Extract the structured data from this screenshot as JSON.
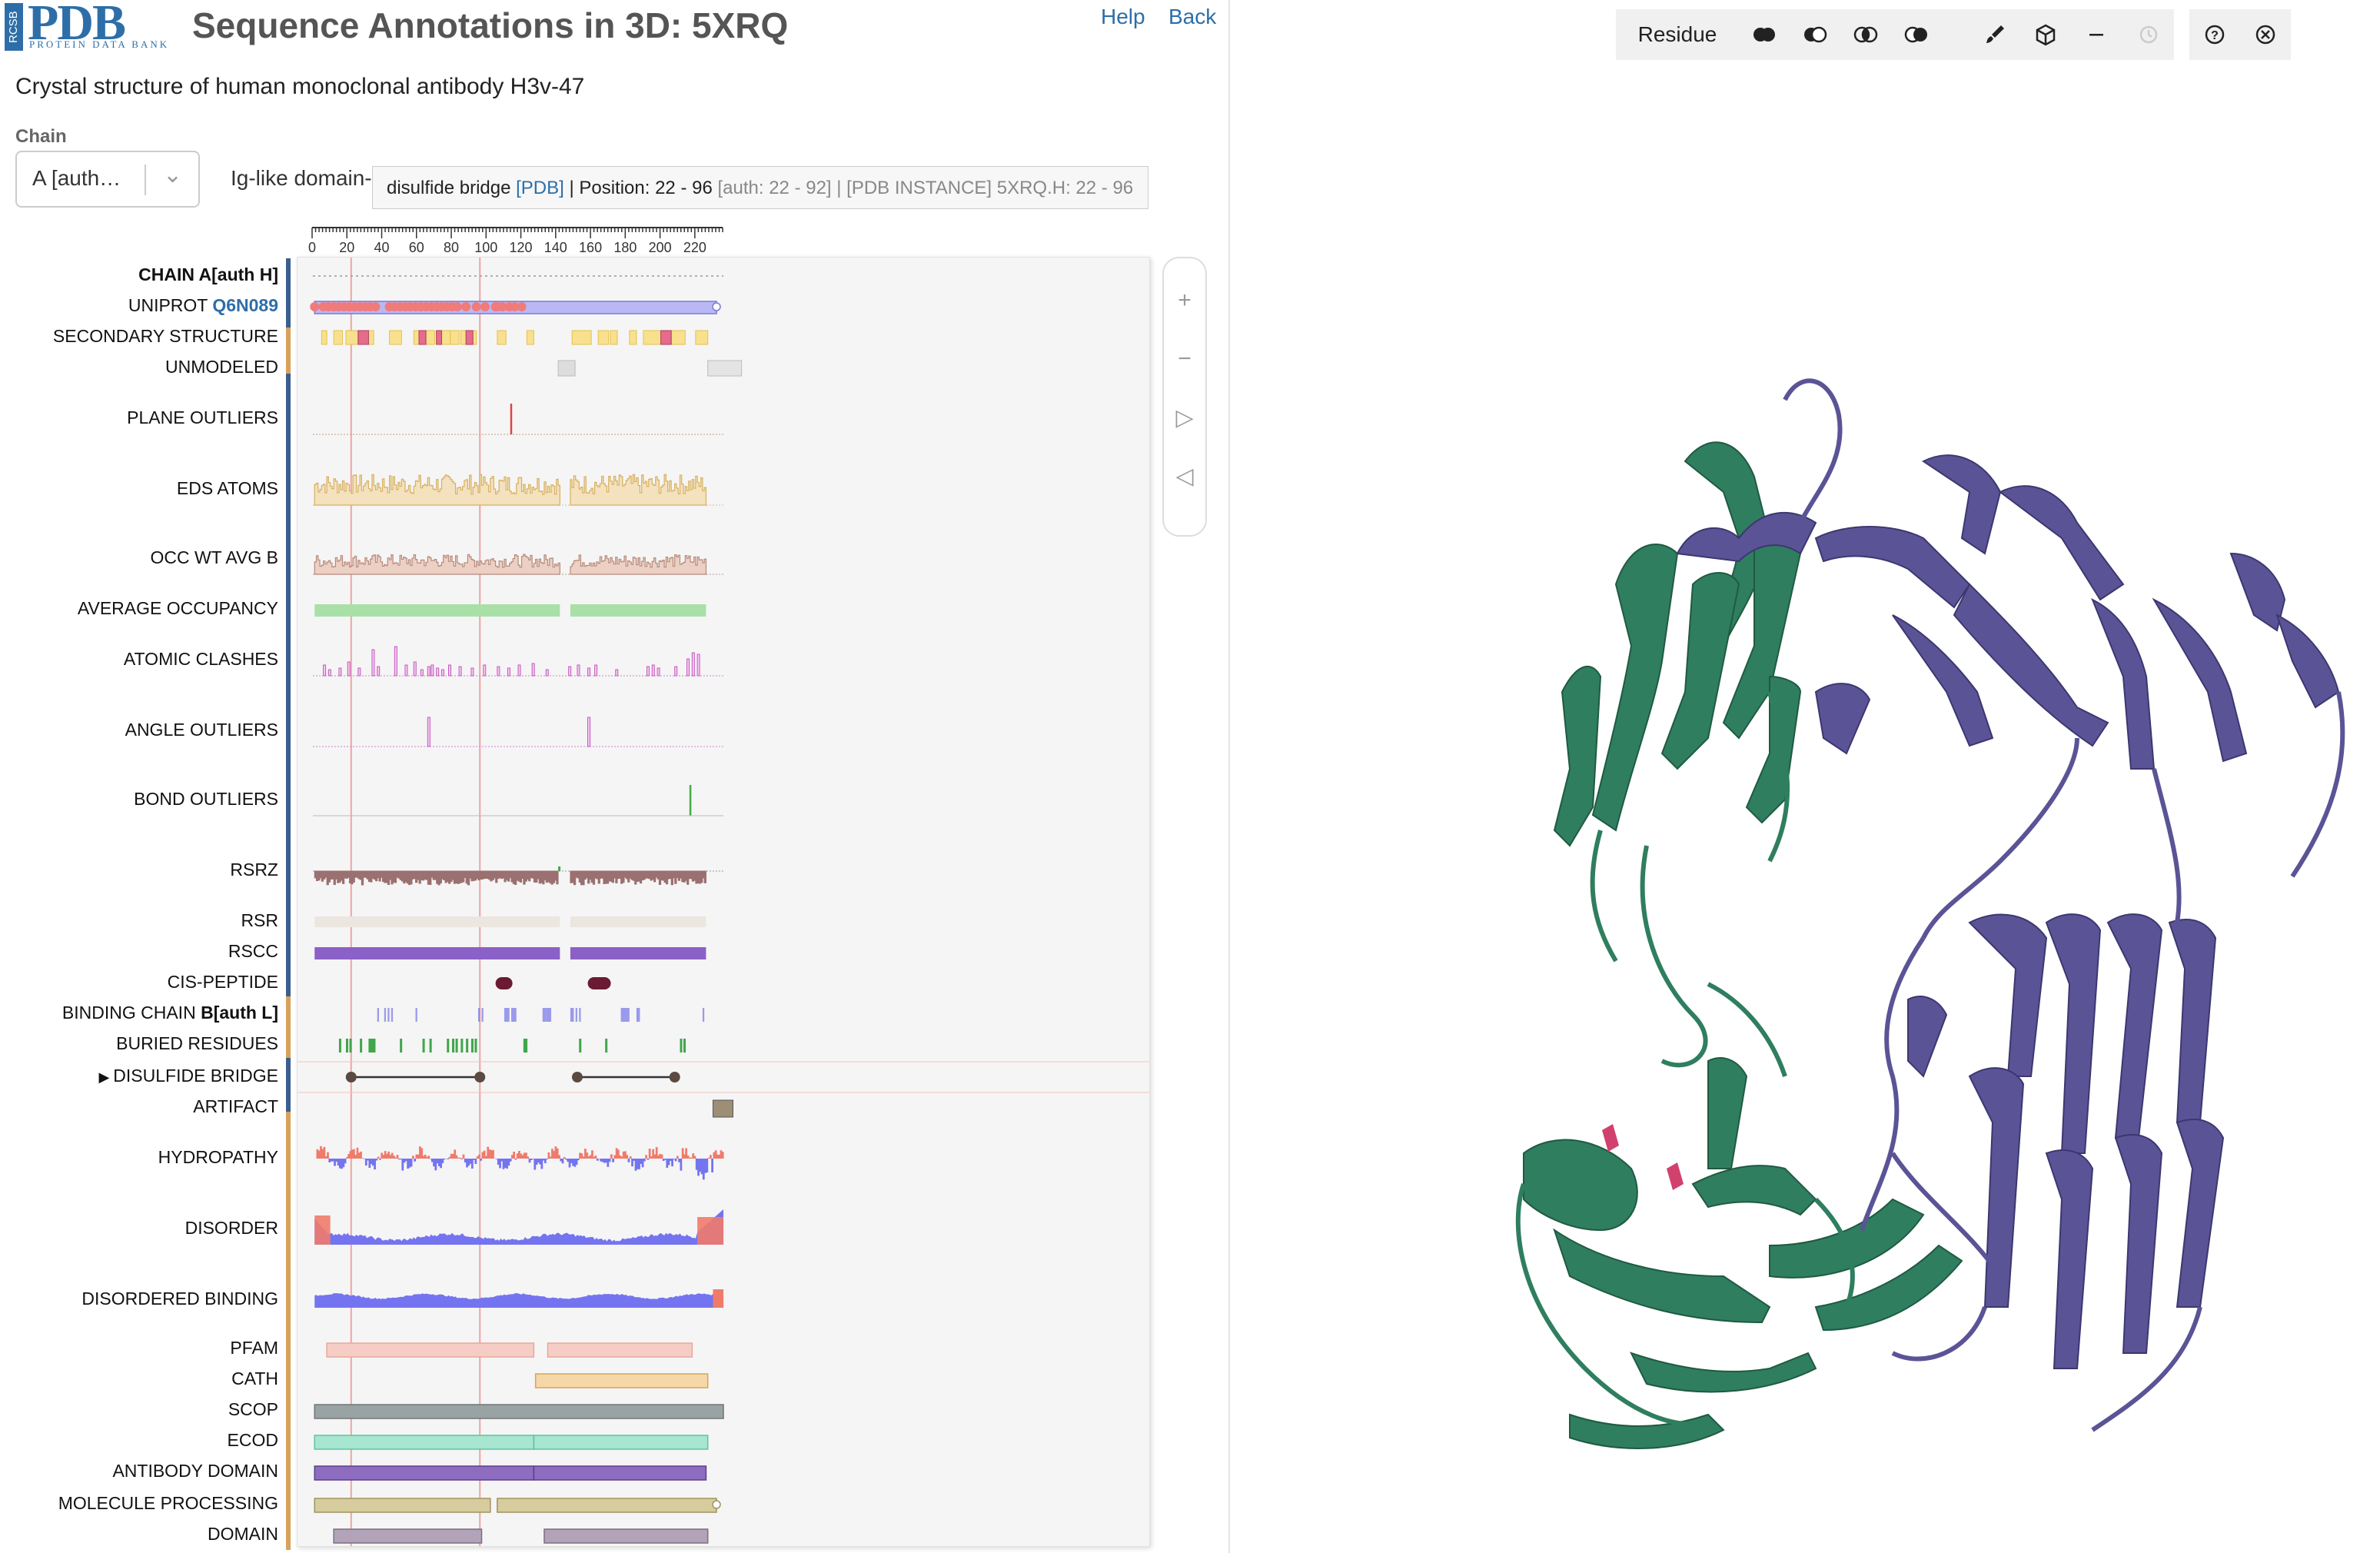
{
  "header": {
    "logo_mark": "RCSB",
    "logo_text": "PDB",
    "logo_sub": "PROTEIN DATA BANK",
    "title": "Sequence Annotations in 3D: 5XRQ",
    "help": "Help",
    "back": "Back",
    "subtitle": "Crystal structure of human monoclonal antibody H3v-47"
  },
  "chain": {
    "label": "Chain",
    "selected": "A [auth…",
    "domain_label": "Ig-like domain-"
  },
  "tooltip": {
    "prefix": "disulfide bridge ",
    "source": "[PDB]",
    "position": " | Position: 22 - 96 ",
    "details": "[auth: 22 - 92] | [PDB INSTANCE] 5XRQ.H: 22 - 96"
  },
  "axis": {
    "ticks": [
      "0",
      "20",
      "40",
      "60",
      "80",
      "100",
      "120",
      "140",
      "160",
      "180",
      "200",
      "220"
    ]
  },
  "tracks": [
    {
      "id": "chain",
      "label_bold": "CHAIN A[auth H]"
    },
    {
      "id": "uniprot",
      "label": "UNIPROT",
      "accession": "Q6N089"
    },
    {
      "id": "ss",
      "label": "SECONDARY STRUCTURE"
    },
    {
      "id": "unmodeled",
      "label": "UNMODELED"
    },
    {
      "id": "plane",
      "label": "PLANE OUTLIERS"
    },
    {
      "id": "eds",
      "label": "EDS ATOMS"
    },
    {
      "id": "occ",
      "label": "OCC WT AVG B"
    },
    {
      "id": "avgocc",
      "label": "AVERAGE OCCUPANCY"
    },
    {
      "id": "clash",
      "label": "ATOMIC CLASHES"
    },
    {
      "id": "angle",
      "label": "ANGLE OUTLIERS"
    },
    {
      "id": "bond",
      "label": "BOND OUTLIERS"
    },
    {
      "id": "rsrz",
      "label": "RSRZ"
    },
    {
      "id": "rsr",
      "label": "RSR"
    },
    {
      "id": "rscc",
      "label": "RSCC"
    },
    {
      "id": "cis",
      "label": "CIS-PEPTIDE"
    },
    {
      "id": "binding",
      "label": "BINDING CHAIN",
      "label_bold": "B[auth L]"
    },
    {
      "id": "buried",
      "label": "BURIED RESIDUES"
    },
    {
      "id": "disulfide",
      "label": "DISULFIDE BRIDGE"
    },
    {
      "id": "artifact",
      "label": "ARTIFACT"
    },
    {
      "id": "hydro",
      "label": "HYDROPATHY"
    },
    {
      "id": "disorder",
      "label": "DISORDER"
    },
    {
      "id": "disbind",
      "label": "DISORDERED BINDING"
    },
    {
      "id": "pfam",
      "label": "PFAM"
    },
    {
      "id": "cath",
      "label": "CATH"
    },
    {
      "id": "scop",
      "label": "SCOP"
    },
    {
      "id": "ecod",
      "label": "ECOD"
    },
    {
      "id": "abdomain",
      "label": "ANTIBODY DOMAIN"
    },
    {
      "id": "molproc",
      "label": "MOLECULE PROCESSING"
    },
    {
      "id": "domain",
      "label": "DOMAIN"
    }
  ],
  "zoom": {
    "zoom_in": "+",
    "zoom_out": "−",
    "next": "▷",
    "prev": "◁"
  },
  "viewer_toolbar": {
    "residue": "Residue",
    "buttons": [
      "fill-both-icon",
      "half-left-icon",
      "overlap-icon",
      "half-right-icon",
      "brush-icon",
      "cube-icon",
      "minus-icon",
      "history-icon",
      "help-circle-icon",
      "close-circle-icon"
    ]
  },
  "colors": {
    "accent": "#2e6ea8",
    "chain_green": "#2f7e5f",
    "chain_purple": "#5a5496",
    "label_bar_blue": "#3a5f8f",
    "label_bar_orange": "#d7a25a"
  }
}
